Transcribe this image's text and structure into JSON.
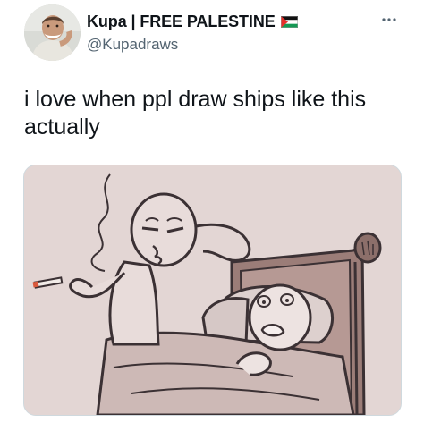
{
  "author": {
    "display_name": "Kupa | FREE PALESTINE",
    "handle": "@Kupadraws",
    "avatar_icon": "profile-photo",
    "flag_icon": "palestine-flag-icon"
  },
  "menu": {
    "more_icon": "more-dots-icon"
  },
  "tweet": {
    "text": "i love when ppl draw ships like this\nactually"
  },
  "media": {
    "kind": "illustration",
    "icon": "comic-drawing",
    "colors": {
      "background": "#e3d6d4",
      "line": "#3b3134",
      "wood": "#8c6f6a",
      "sheet": "#cdb9b6"
    }
  }
}
